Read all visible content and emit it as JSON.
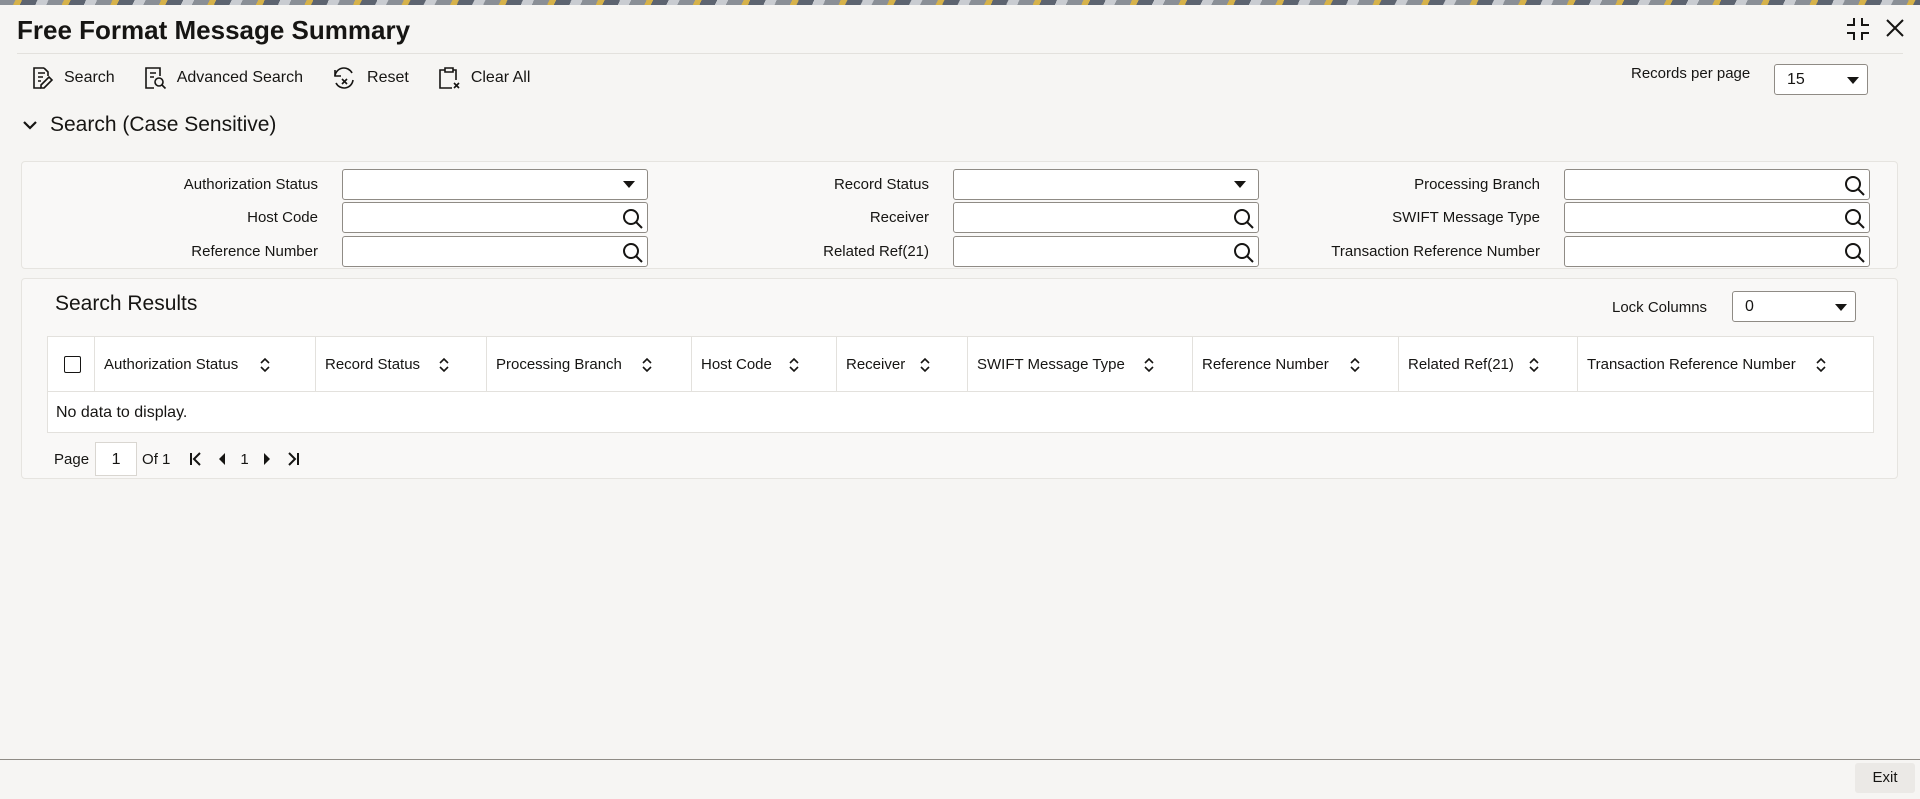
{
  "window": {
    "title": "Free Format Message Summary",
    "icons": [
      "collapse-icon",
      "close-icon"
    ]
  },
  "toolbar": {
    "search_label": "Search",
    "advanced_search_label": "Advanced Search",
    "reset_label": "Reset",
    "clear_all_label": "Clear All"
  },
  "records_per_page": {
    "label": "Records per page",
    "value": "15"
  },
  "search_section": {
    "title": "Search (Case Sensitive)",
    "fields": {
      "authorization_status": {
        "label": "Authorization Status",
        "value": ""
      },
      "record_status": {
        "label": "Record Status",
        "value": ""
      },
      "processing_branch": {
        "label": "Processing Branch",
        "value": ""
      },
      "host_code": {
        "label": "Host Code",
        "value": ""
      },
      "receiver": {
        "label": "Receiver",
        "value": ""
      },
      "swift_message_type": {
        "label": "SWIFT Message Type",
        "value": ""
      },
      "reference_number": {
        "label": "Reference Number",
        "value": ""
      },
      "related_ref": {
        "label": "Related Ref(21)",
        "value": ""
      },
      "transaction_reference_number": {
        "label": "Transaction Reference Number",
        "value": ""
      }
    }
  },
  "results": {
    "title": "Search Results",
    "lock_columns_label": "Lock Columns",
    "lock_columns_value": "0",
    "columns": [
      "Authorization Status",
      "Record Status",
      "Processing Branch",
      "Host Code",
      "Receiver",
      "SWIFT Message Type",
      "Reference Number",
      "Related Ref(21)",
      "Transaction Reference Number"
    ],
    "rows": [],
    "empty_text": "No data to display."
  },
  "pagination": {
    "page_label": "Page",
    "current_page": "1",
    "of_label": "Of 1",
    "nav_page": "1"
  },
  "footer": {
    "exit_label": "Exit"
  },
  "colors": {
    "text": "#161513",
    "border": "#8f8b85",
    "panel": "#f9f8f7",
    "background": "#f6f5f3"
  }
}
